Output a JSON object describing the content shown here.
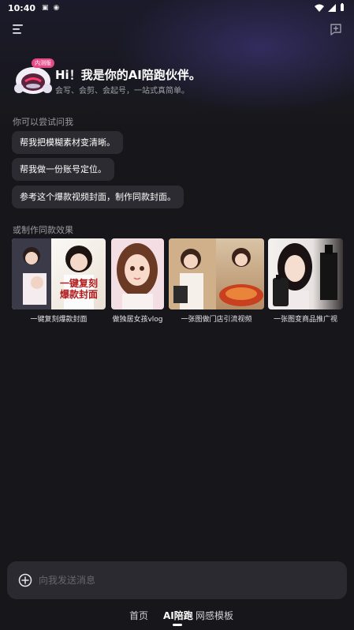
{
  "status_bar": {
    "time": "10:40"
  },
  "hero": {
    "badge": "内测版",
    "title": "Hi！我是你的AI陪跑伙伴。",
    "subtitle": "会写、会剪、会起号，一站式真简单。"
  },
  "suggest": {
    "label": "你可以尝试问我",
    "chips": [
      "帮我把模糊素材变清晰。",
      "帮我做一份账号定位。",
      "参考这个爆款视频封面，制作同款封面。"
    ]
  },
  "make": {
    "label": "或制作同款效果",
    "cards": [
      {
        "label": "一键复刻爆款封面",
        "overlay": "一键复刻 爆款封面"
      },
      {
        "label": "做独居女孩vlog"
      },
      {
        "label": "一张图做门店引流视频"
      },
      {
        "label": "一张图变商品推广视"
      }
    ]
  },
  "input": {
    "placeholder": "向我发送消息"
  },
  "nav": {
    "home": "首页",
    "ai": "AI陪跑",
    "templates": "网感模板"
  },
  "colors": {
    "background": "#17171b",
    "chip": "#2b2b31",
    "accent": "#e64a86"
  }
}
